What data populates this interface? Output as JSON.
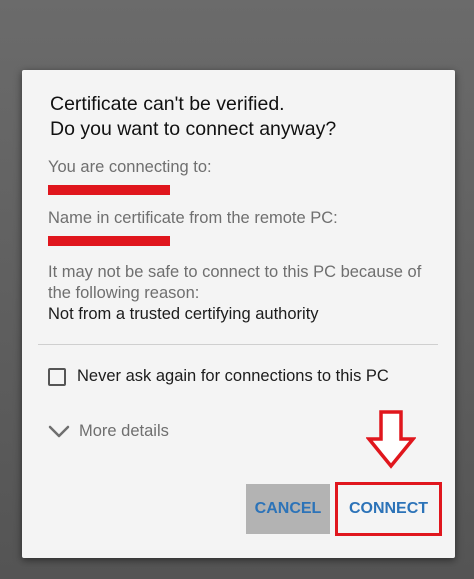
{
  "dialog": {
    "title_line1": "Certificate can't be verified.",
    "title_line2": "Do you want to connect anyway?",
    "connecting_label": "You are connecting to:",
    "cert_name_label": "Name in certificate from the remote PC:",
    "warning_text": "It may not be safe to connect to this PC because of the following reason:",
    "reason_text": "Not from a trusted certifying authority",
    "checkbox_label": "Never ask again for connections to this PC",
    "checkbox_checked": false,
    "details_label": "More details",
    "cancel_label": "CANCEL",
    "connect_label": "CONNECT"
  },
  "colors": {
    "accent": "#2c73b8",
    "highlight_red": "#e0161d",
    "cancel_bg": "#b3b3b3"
  },
  "icons": {
    "chevron": "chevron-down-icon",
    "arrow": "arrow-down-outline-icon",
    "checkbox": "checkbox-unchecked-icon"
  }
}
